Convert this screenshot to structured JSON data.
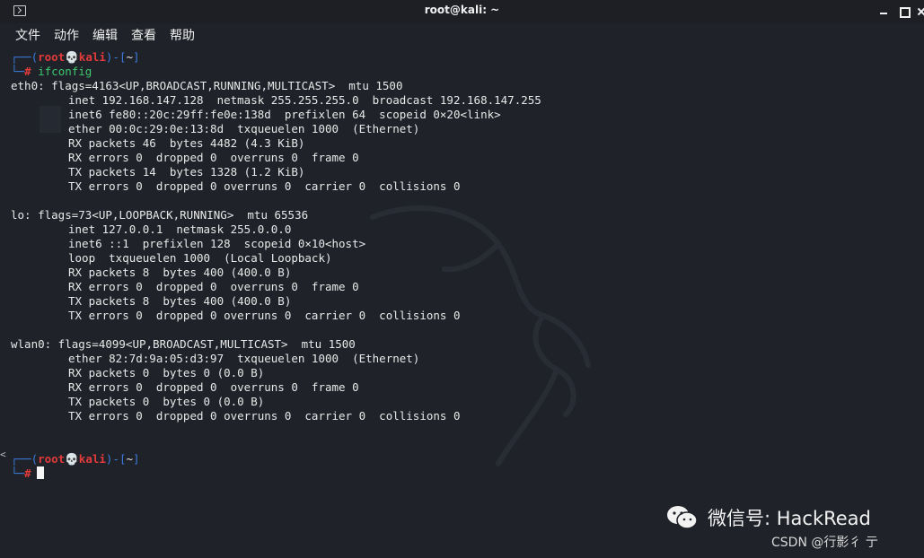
{
  "window": {
    "title": "root@kali: ~",
    "icons": {
      "app": "terminal-icon",
      "minimize": "minimize-icon",
      "maximize": "maximize-icon",
      "close": "close-icon"
    }
  },
  "menu": [
    "文件",
    "动作",
    "编辑",
    "查看",
    "帮助"
  ],
  "prompt": {
    "corner_top": "┌──(",
    "user": "root",
    "skull": "💀",
    "host": "kali",
    "mid": ")-[",
    "path": "~",
    "end": "]",
    "corner_bottom": "└─",
    "hash": "#"
  },
  "command": "ifconfig",
  "output": {
    "eth0": {
      "header": "eth0: flags=4163<UP,BROADCAST,RUNNING,MULTICAST>  mtu 1500",
      "lines": [
        "inet 192.168.147.128  netmask 255.255.255.0  broadcast 192.168.147.255",
        "inet6 fe80::20c:29ff:fe0e:138d  prefixlen 64  scopeid 0×20<link>",
        "ether 00:0c:29:0e:13:8d  txqueuelen 1000  (Ethernet)",
        "RX packets 46  bytes 4482 (4.3 KiB)",
        "RX errors 0  dropped 0  overruns 0  frame 0",
        "TX packets 14  bytes 1328 (1.2 KiB)",
        "TX errors 0  dropped 0 overruns 0  carrier 0  collisions 0"
      ]
    },
    "lo": {
      "header": "lo: flags=73<UP,LOOPBACK,RUNNING>  mtu 65536",
      "lines": [
        "inet 127.0.0.1  netmask 255.0.0.0",
        "inet6 ::1  prefixlen 128  scopeid 0×10<host>",
        "loop  txqueuelen 1000  (Local Loopback)",
        "RX packets 8  bytes 400 (400.0 B)",
        "RX errors 0  dropped 0  overruns 0  frame 0",
        "TX packets 8  bytes 400 (400.0 B)",
        "TX errors 0  dropped 0 overruns 0  carrier 0  collisions 0"
      ]
    },
    "wlan0": {
      "header": "wlan0: flags=4099<UP,BROADCAST,MULTICAST>  mtu 1500",
      "lines": [
        "ether 82:7d:9a:05:d3:97  txqueuelen 1000  (Ethernet)",
        "RX packets 0  bytes 0 (0.0 B)",
        "RX errors 0  dropped 0  overruns 0  frame 0",
        "TX packets 0  bytes 0 (0.0 B)",
        "TX errors 0  dropped 0 overruns 0  carrier 0  collisions 0"
      ]
    }
  },
  "watermark": {
    "wechat": "微信号: HackRead",
    "csdn": "CSDN @行影彳 亍"
  },
  "colors": {
    "prompt_blue": "#3b7bdc",
    "prompt_red": "#e23a3a",
    "command_green": "#3ec76f",
    "background": "#1f2229"
  }
}
